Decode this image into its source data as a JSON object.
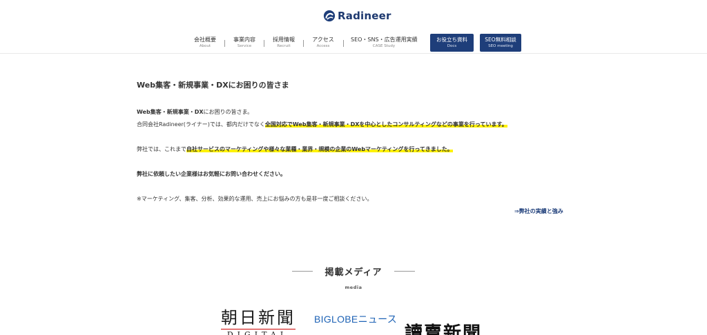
{
  "header": {
    "logo_text": "Radineer",
    "nav": [
      {
        "jp": "会社概要",
        "en": "About"
      },
      {
        "jp": "事業内容",
        "en": "Service"
      },
      {
        "jp": "採用情報",
        "en": "Recruit"
      },
      {
        "jp": "アクセス",
        "en": "Access"
      },
      {
        "jp": "SEO・SNS・広告運用実績",
        "en": "CASE Study"
      }
    ],
    "buttons": [
      {
        "jp": "お役立ち資料",
        "en": "Docs"
      },
      {
        "jp": "SEO無料相談",
        "en": "SEO meeting"
      }
    ],
    "colors": {
      "brand": "#1e3e7a"
    }
  },
  "main": {
    "title": "Web集客・新規事業・DXにお困りの皆さま",
    "p1_bold": "Web集客・新規事業・DX",
    "p1_rest": "にお困りの皆さま。",
    "p2_pre": "合同会社Radineer(ライナー)では、都内だけでなく",
    "p2_hl": "全国対応でWeb集客・新規事業・DXを中心としたコンサルティングなどの事業を行っています。",
    "p3_pre": "弊社では、これまで",
    "p3_hl": "自社サービスのマーケティングや様々な業種・業界・規模の企業のWebマーケティングを行ってきました。",
    "p4": "弊社に依頼したい企業様はお気軽にお問い合わせください。",
    "p5": "※マーケティング、集客、分析、効果的な運用、売上にお悩みの方も是非一度ご相談ください。",
    "link": "⇒弊社の実績と強み",
    "colors": {
      "highlight": "#fff200"
    }
  },
  "media": {
    "title": "掲載メディア",
    "sub": "media",
    "logos": {
      "asahi_top": "朝日新聞",
      "asahi_bottom": "DIGITAL",
      "biglobe": "BIGLOBEニュース",
      "yomiuri": "讀賣新聞"
    }
  }
}
